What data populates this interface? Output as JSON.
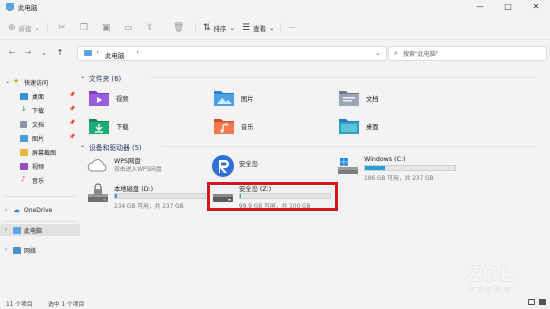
{
  "window": {
    "title": "此电脑",
    "controls": [
      "—",
      "□",
      "✕"
    ]
  },
  "toolbar": {
    "new_label": "新建",
    "sort_label": "排序",
    "view_label": "查看",
    "more_label": "···"
  },
  "address": {
    "crumb": "此电脑",
    "search_placeholder": "搜索\"此电脑\""
  },
  "sidebar": {
    "quick_access": "快速访问",
    "items": [
      {
        "label": "桌面"
      },
      {
        "label": "下载"
      },
      {
        "label": "文档"
      },
      {
        "label": "图片"
      },
      {
        "label": "屏幕截图"
      },
      {
        "label": "视频"
      },
      {
        "label": "音乐"
      }
    ],
    "onedrive": "OneDrive",
    "this_pc": "此电脑",
    "network": "网络"
  },
  "content": {
    "folders_header": "文件夹 (6)",
    "folders": [
      {
        "name": "视频"
      },
      {
        "name": "图片"
      },
      {
        "name": "文档"
      },
      {
        "name": "下载"
      },
      {
        "name": "音乐"
      },
      {
        "name": "桌面"
      }
    ],
    "drives_header": "设备和驱动器 (5)",
    "drives": [
      {
        "name": "WPS网盘",
        "sub": "双击进入WPS网盘"
      },
      {
        "name": "安全岛"
      },
      {
        "name": "Windows (C:)",
        "free": "186 GB 可用，共 237 GB",
        "used_fraction": 0.22
      },
      {
        "name": "本地磁盘 (D:)",
        "free": "234 GB 可用，共 237 GB",
        "used_fraction": 0.02
      },
      {
        "name": "安全岛 (Z:)",
        "free": "99.9 GB 可用，共 100 GB",
        "used_fraction": 0.01
      }
    ]
  },
  "status": {
    "count": "11 个项目",
    "selected": "选中 1 个项目"
  },
  "watermark": {
    "main": "ZOL",
    "sub": "中关村在线"
  },
  "colors": {
    "accent": "#26a0da",
    "highlight": "#d7151c"
  }
}
